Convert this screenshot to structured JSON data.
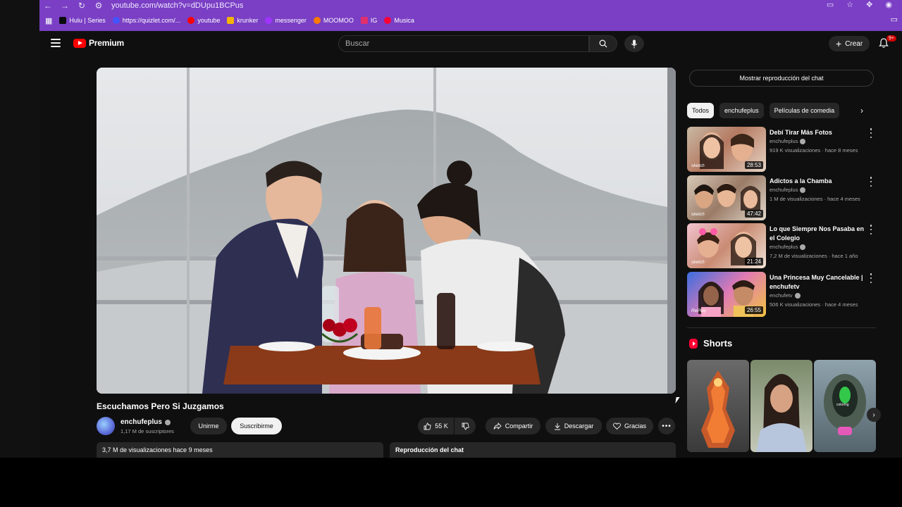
{
  "browser": {
    "url": "youtube.com/watch?v=dDUpu1BCPus",
    "bookmarks": [
      {
        "label": "Hulu | Series",
        "color": "#1ce783"
      },
      {
        "label": "https://quizlet.com/...",
        "color": "#4255ff"
      },
      {
        "label": "youtube",
        "color": "#ff0000"
      },
      {
        "label": "krunker",
        "color": "#f4b400"
      },
      {
        "label": "messenger",
        "color": "#a033ff"
      },
      {
        "label": "MOOMOO",
        "color": "#ff7a00"
      },
      {
        "label": "IG",
        "color": "#e1306c"
      },
      {
        "label": "Musica",
        "color": "#ff0033"
      }
    ]
  },
  "header": {
    "logo_text": "Premium",
    "search_placeholder": "Buscar",
    "create_label": "Crear",
    "notif_count": "9+"
  },
  "video": {
    "title": "Escuchamos Pero Si Juzgamos",
    "channel": "enchufeplus",
    "subscribers": "1,17 M de suscriptores",
    "join_label": "Unirme",
    "subscribe_label": "Suscribirme",
    "likes": "55 K",
    "share_label": "Compartir",
    "download_label": "Descargar",
    "thanks_label": "Gracias",
    "views_date": "3,7 M de visualizaciones  hace 9 meses",
    "chat_replay_label": "Reproducción del chat"
  },
  "sidebar": {
    "show_chat_label": "Mostrar reproducción del chat",
    "chips": [
      "Todos",
      "enchufeplus",
      "Películas de comedia"
    ],
    "recommendations": [
      {
        "title": "Debí Tirar Más Fotos",
        "channel": "enchufeplus",
        "meta": "919 K visualizaciones · hace 8 meses",
        "duration": "28:53",
        "badge": "sketch"
      },
      {
        "title": "Adictos a la Chamba",
        "channel": "enchufeplus",
        "meta": "1 M de visualizaciones · hace 4 meses",
        "duration": "47:42",
        "badge": "sketch"
      },
      {
        "title": "Lo que Siempre Nos Pasaba en el Colegio",
        "channel": "enchufeplus",
        "meta": "7,2 M de visualizaciones · hace 1 año",
        "duration": "21:24",
        "badge": "sketch"
      },
      {
        "title": "Una Princesa Muy Cancelable | enchufetv",
        "channel": "enchufetv",
        "meta": "506 K visualizaciones · hace 4 meses",
        "duration": "26:55",
        "badge": "RePlay"
      }
    ],
    "shorts_title": "Shorts",
    "short_overlay_text": "coloring"
  }
}
